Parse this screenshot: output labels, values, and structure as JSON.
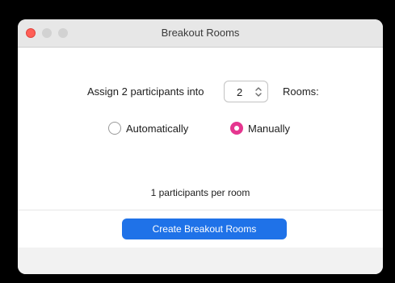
{
  "window": {
    "title": "Breakout Rooms"
  },
  "assign": {
    "prefix_label": "Assign 2 participants into",
    "room_count": "2",
    "suffix_label": "Rooms:"
  },
  "mode": {
    "automatic_label": "Automatically",
    "manual_label": "Manually",
    "selected": "Manually"
  },
  "summary": {
    "per_room_text": "1 participants per room"
  },
  "actions": {
    "create_label": "Create Breakout Rooms"
  },
  "colors": {
    "accent_button": "#1f72e8",
    "radio_selected": "#e5368f",
    "close_button": "#ff5f57"
  },
  "icons": {
    "stepper": "up-down-chevron-icon"
  }
}
